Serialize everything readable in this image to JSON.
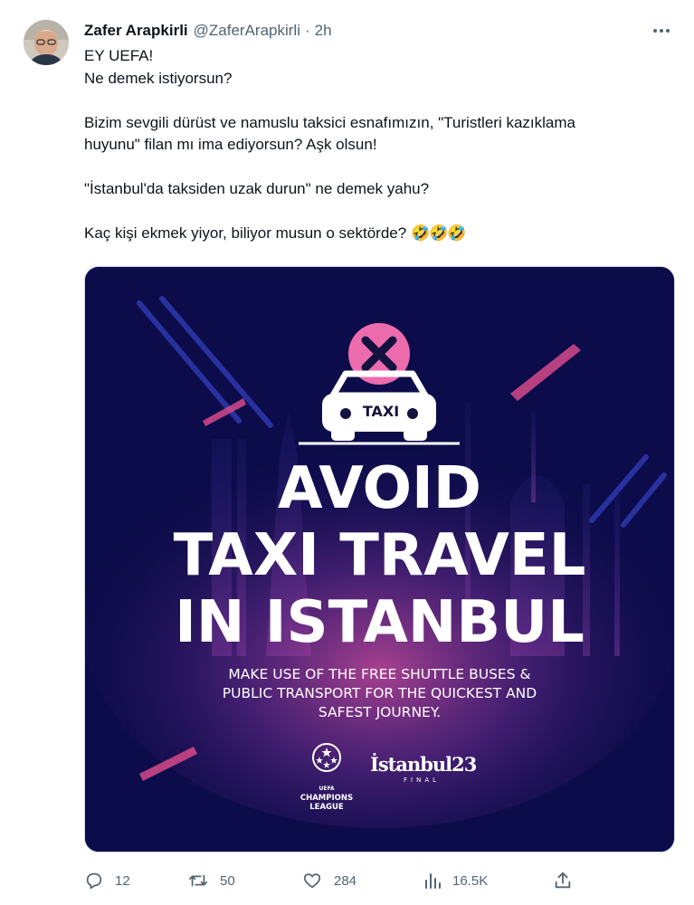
{
  "tweet": {
    "author_name": "Zafer Arapkirli",
    "handle": "@ZaferArapkirli",
    "separator": "·",
    "time": "2h",
    "lines": [
      "EY UEFA!",
      "Ne demek istiyorsun?",
      "",
      "Bizim sevgili dürüst ve namuslu taksici esnafımızın, \"Turistleri kazıklama",
      "huyunu\" filan mı ima ediyorsun? Aşk olsun!",
      "",
      "\"İstanbul'da taksiden uzak durun\" ne demek yahu?",
      "",
      "Kaç kişi ekmek yiyor, biliyor musun o sektörde?"
    ],
    "emojis": "🤣🤣🤣"
  },
  "media": {
    "taxi_sign": "TAXI",
    "headline": [
      "AVOID",
      "TAXI TRAVEL",
      "IN ISTANBUL"
    ],
    "subtext": [
      "MAKE USE OF THE FREE SHUTTLE BUSES &",
      "PUBLIC TRANSPORT FOR THE QUICKEST AND",
      "SAFEST JOURNEY."
    ],
    "ucl_label": [
      "UEFA",
      "CHAMPIONS",
      "LEAGUE"
    ],
    "istanbul_logo": "İstanbul23",
    "istanbul_final": "FINAL",
    "colors": {
      "background": "#0d0c4b",
      "accent_pink": "#ec6cae",
      "glow": "#c44a9c"
    }
  },
  "actions": {
    "replies": "12",
    "retweets": "50",
    "likes": "284",
    "views": "16.5K"
  },
  "icons": [
    "more-icon",
    "reply-icon",
    "retweet-icon",
    "like-icon",
    "views-icon",
    "share-icon",
    "close-x-icon",
    "taxi-icon",
    "ucl-starball-icon"
  ]
}
